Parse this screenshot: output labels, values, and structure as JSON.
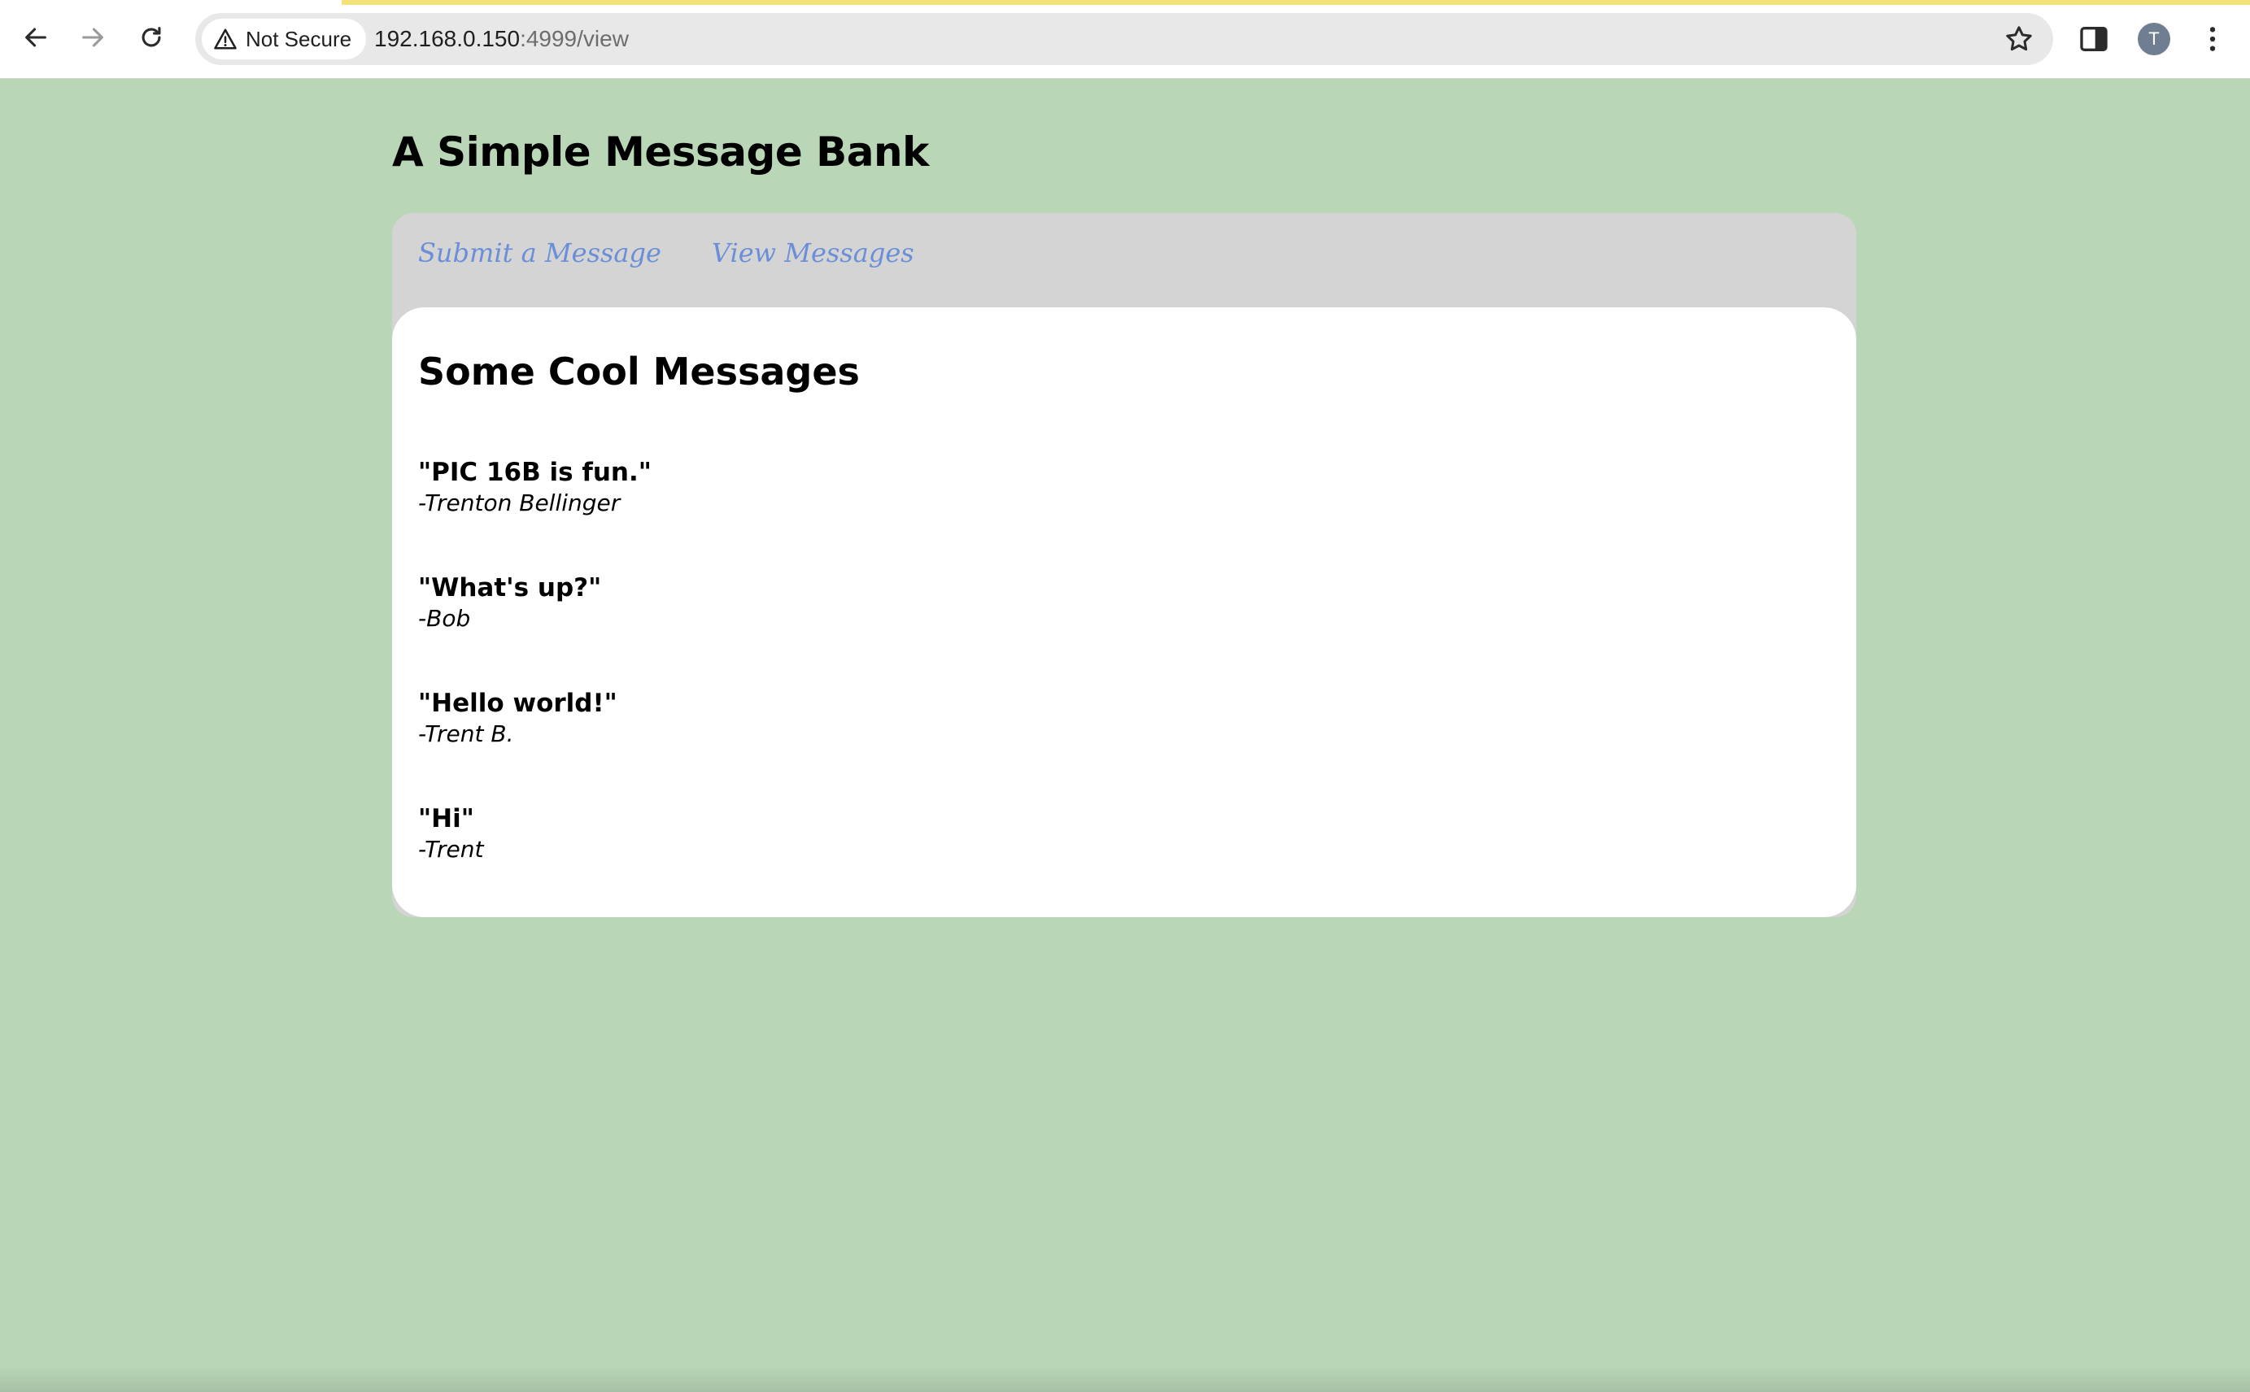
{
  "browser": {
    "security_label": "Not Secure",
    "url_host": "192.168.0.150",
    "url_path": ":4999/view",
    "profile_initial": "T"
  },
  "page": {
    "title": "A Simple Message Bank",
    "nav": {
      "submit_label": "Submit a Message",
      "view_label": "View Messages"
    },
    "section_title": "Some Cool Messages",
    "messages": [
      {
        "text": "\"PIC 16B is fun.\"",
        "author": "-Trenton Bellinger"
      },
      {
        "text": "\"What's up?\"",
        "author": "-Bob"
      },
      {
        "text": "\"Hello world!\"",
        "author": "-Trent B."
      },
      {
        "text": "\"Hi\"",
        "author": "-Trent"
      }
    ]
  },
  "colors": {
    "page_background": "#b9d6b7",
    "nav_panel": "#d4d4d4",
    "link": "#6a8fd8",
    "content_background": "#ffffff"
  },
  "icons": [
    "back-icon",
    "forward-icon",
    "reload-icon",
    "warning-icon",
    "star-icon",
    "side-panel-icon",
    "kebab-menu-icon"
  ]
}
